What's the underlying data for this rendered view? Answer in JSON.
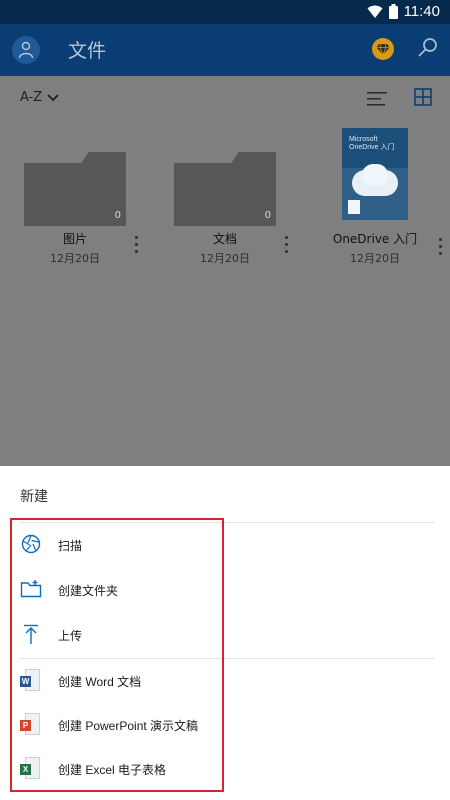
{
  "status_bar": {
    "time": "11:40"
  },
  "app_bar": {
    "title": "文件",
    "accent": "#093d74"
  },
  "toolbar": {
    "sort_label": "A-Z"
  },
  "files": [
    {
      "name": "图片",
      "date": "12月20日",
      "count": "0",
      "type": "folder"
    },
    {
      "name": "文档",
      "date": "12月20日",
      "count": "0",
      "type": "folder"
    },
    {
      "name": "OneDrive 入门",
      "date": "12月20日",
      "type": "document"
    }
  ],
  "sheet": {
    "title": "新建",
    "actions": [
      {
        "label": "扫描",
        "icon": "camera-shutter-icon"
      },
      {
        "label": "创建文件夹",
        "icon": "add-folder-icon"
      },
      {
        "label": "上传",
        "icon": "upload-icon"
      },
      {
        "label": "创建 Word 文档",
        "icon": "word-icon"
      },
      {
        "label": "创建 PowerPoint 演示文稿",
        "icon": "powerpoint-icon"
      },
      {
        "label": "创建 Excel 电子表格",
        "icon": "excel-icon"
      }
    ]
  },
  "colors": {
    "status_bar": "#062a4c",
    "highlight": "#d9232f",
    "word": "#2b579a",
    "powerpoint": "#d24726",
    "excel": "#217346"
  }
}
